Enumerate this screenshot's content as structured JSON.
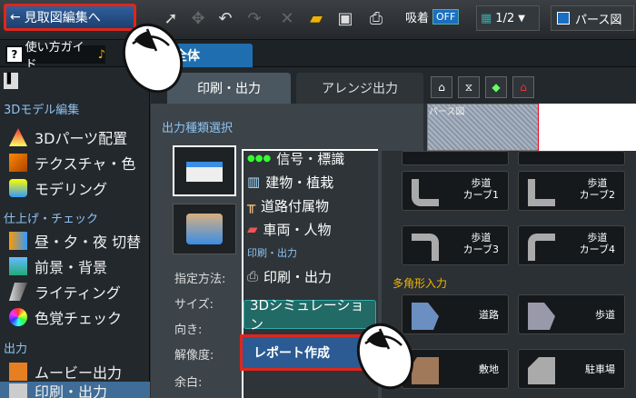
{
  "toolbar": {
    "back_label": "見取図編集へ",
    "snap_label": "吸着",
    "snap_state": "OFF",
    "grid_value": "1/2",
    "perspective_label": "パース図"
  },
  "row2": {
    "guide_label": "使い方ガイド",
    "all_tab": "全体"
  },
  "sidebar": {
    "sections": [
      "3Dモデル編集",
      "仕上げ・チェック",
      "出力"
    ],
    "items_3d": [
      "3Dパーツ配置",
      "テクスチャ・色",
      "モデリング"
    ],
    "items_finish": [
      "昼・夕・夜 切替",
      "前景・背景",
      "ライティング",
      "色覚チェック"
    ],
    "items_output": [
      "ムービー出力",
      "印刷・出力"
    ]
  },
  "tabs": {
    "print": "印刷・出力",
    "arrange": "アレンジ出力"
  },
  "panel": {
    "output_type_label": "出力種類選択",
    "fields": [
      "指定方法:",
      "サイズ:",
      "向き:",
      "解像度:",
      "余白:"
    ]
  },
  "preview": {
    "label": "パース図"
  },
  "dropdown": {
    "items": [
      "信号・標識",
      "建物・植栽",
      "道路付属物",
      "車両・人物"
    ],
    "section": "印刷・出力",
    "print_item": "印刷・出力",
    "sim_button": "3Dシミュレーション",
    "report_button": "レポート作成"
  },
  "right": {
    "tiles": [
      "歩道\nカーブ1",
      "歩道\nカーブ2",
      "歩道\nカーブ3",
      "歩道\nカーブ4"
    ],
    "poly_label": "多角形入力",
    "poly_tiles": [
      "道路",
      "歩道",
      "敷地",
      "駐車場"
    ]
  },
  "colors": {
    "highlight_red": "#e0261b",
    "accent_blue": "#1f6fb0",
    "section_blue": "#8ec3f3",
    "poly_yellow": "#f1b600"
  }
}
